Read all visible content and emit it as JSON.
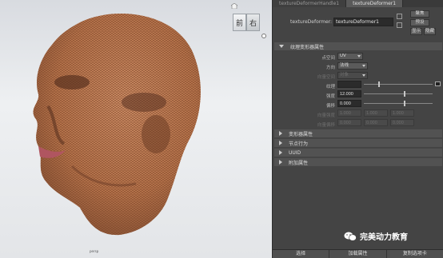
{
  "viewport": {
    "cube_front": "前",
    "cube_right": "右",
    "camera_label": "persp"
  },
  "panel": {
    "tabs": [
      "textureDeformerHandle1",
      "textureDeformer1"
    ],
    "node_label": "textureDeformer:",
    "node_value": "textureDeformer1",
    "buttons": {
      "focus": "聚焦",
      "presets": "预设",
      "show": "显示",
      "hide": "隐藏"
    },
    "sections": {
      "texture_attrs": "纹理变形器属性",
      "deformer_attrs": "变形器属性",
      "node_behavior": "节点行为",
      "uuid": "UUID",
      "extra_attrs": "附加属性"
    },
    "attrs": {
      "point_space_label": "点空间",
      "point_space_value": "UV",
      "direction_label": "方向",
      "direction_value": "法线",
      "vector_space_label": "向量空间",
      "vector_space_value": "对象",
      "texture_label": "纹理",
      "strength_label": "强度",
      "strength_value": "12.000",
      "offset_label": "偏移",
      "offset_value": "0.000",
      "vec_strength_label": "向量强度",
      "vec_strength_values": [
        "1.000",
        "1.000",
        "1.000"
      ],
      "vec_offset_label": "向量偏移",
      "vec_offset_values": [
        "0.000",
        "0.000",
        "0.000"
      ]
    },
    "bottom_buttons": [
      "选择",
      "加载属性",
      "复制选项卡"
    ]
  },
  "watermark": "完美动力教育",
  "colors": {
    "skin": "#b8754c",
    "dark_skin": "#5a3220",
    "lip": "#b05560"
  }
}
